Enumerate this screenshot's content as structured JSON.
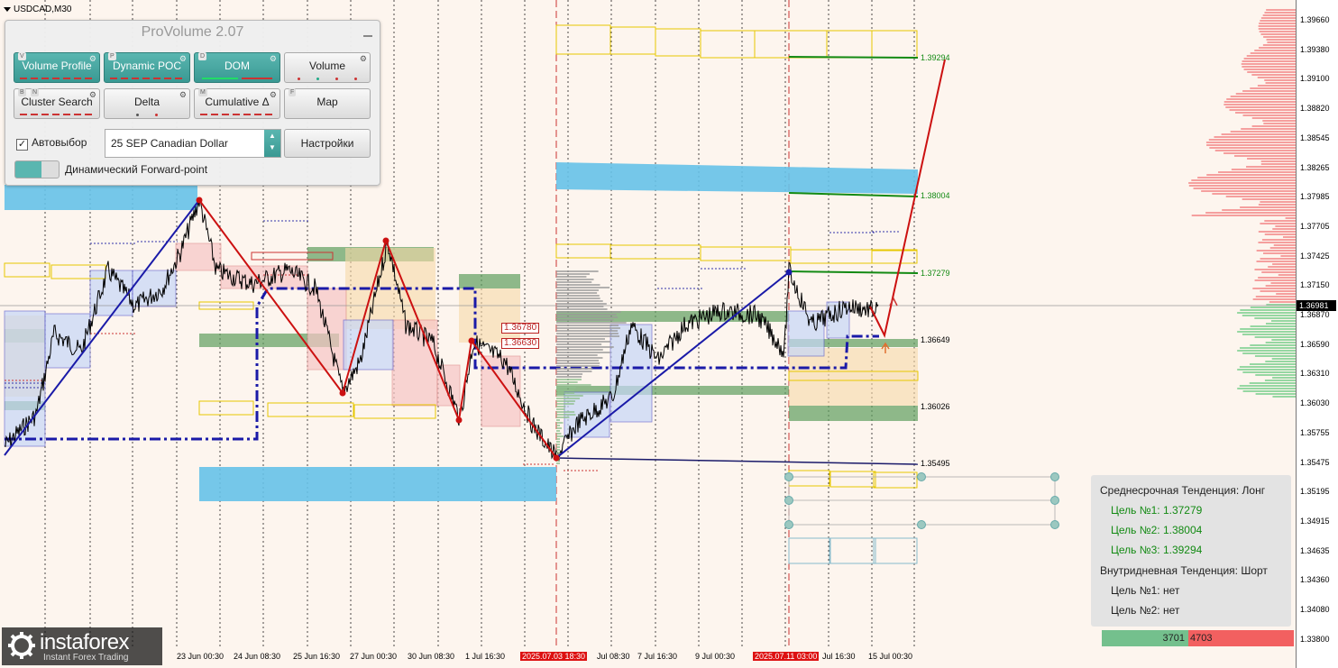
{
  "chart": {
    "symbol": "USDCAD,M30",
    "current_price": "1.36981",
    "colors": {
      "up_trend": "#1a1aa8",
      "down_trend": "#cc1111",
      "level_green": "#138a13",
      "zone_blue": "#66c2e8",
      "zone_green": "#5e9e5e",
      "buy": "#74c08d",
      "sell": "#f26060"
    }
  },
  "price_axis": {
    "ticks": [
      "1.39660",
      "1.39380",
      "1.39100",
      "1.38820",
      "1.38545",
      "1.38265",
      "1.37985",
      "1.37705",
      "1.37425",
      "1.37150",
      "1.36870",
      "1.36590",
      "1.36310",
      "1.36030",
      "1.35755",
      "1.35475",
      "1.35195",
      "1.34915",
      "1.34635",
      "1.34360",
      "1.34080",
      "1.33800"
    ]
  },
  "time_axis": {
    "ticks": [
      {
        "label": "23 Jun 00:30",
        "highlight": false
      },
      {
        "label": "24 Jun 08:30",
        "highlight": false
      },
      {
        "label": "25 Jun 16:30",
        "highlight": false
      },
      {
        "label": "27 Jun 00:30",
        "highlight": false
      },
      {
        "label": "30 Jun 08:30",
        "highlight": false
      },
      {
        "label": "1 Jul 16:30",
        "highlight": false
      },
      {
        "label": "2025.07.03 18:30",
        "highlight": true
      },
      {
        "label": "Jul 08:30",
        "highlight": false
      },
      {
        "label": "7 Jul 16:30",
        "highlight": false
      },
      {
        "label": "9 Jul 00:30",
        "highlight": false
      },
      {
        "label": "2025.07.11 03:00",
        "highlight": true
      },
      {
        "label": "Jul 16:30",
        "highlight": false
      },
      {
        "label": "15 Jul 00:30",
        "highlight": false
      }
    ]
  },
  "levels": [
    "1.39294",
    "1.38004",
    "1.37279",
    "1.36649",
    "1.36026",
    "1.35495"
  ],
  "box_labels": [
    "1.36780",
    "1.36630"
  ],
  "provolume": {
    "title": "ProVolume 2.07",
    "buttons": [
      {
        "label": "Volume Profile",
        "key": "V",
        "on": true
      },
      {
        "label": "Dynamic POC",
        "key": "P",
        "on": true
      },
      {
        "label": "DOM",
        "key": "D",
        "on": true
      },
      {
        "label": "Volume",
        "key": "",
        "on": false
      },
      {
        "label": "Cluster Search",
        "key": "B",
        "key2": "N",
        "on": false
      },
      {
        "label": "Delta",
        "key": "",
        "on": false
      },
      {
        "label": "Cumulative Δ",
        "key": "M",
        "on": false
      },
      {
        "label": "Map",
        "key": "F",
        "on": false
      }
    ],
    "auto_select_label": "Автовыбор",
    "auto_select_checked": "✓",
    "instrument": "25 SEP Canadian Dollar",
    "settings_label": "Настройки",
    "forward_point_label": "Динамический Forward-point"
  },
  "trend": {
    "medium_title": "Среднесрочная Тенденция: Лонг",
    "medium_targets": [
      "Цель №1: 1.37279",
      "Цель №2: 1.38004",
      "Цель №3: 1.39294"
    ],
    "intraday_title": "Внутридневная Тенденция: Шорт",
    "intraday_targets": [
      "Цель №1: нет",
      "Цель №2: нет"
    ],
    "buy_volume": "3701",
    "sell_volume": "4703"
  },
  "watermark": {
    "name": "instaforex",
    "tagline": "Instant Forex Trading"
  }
}
